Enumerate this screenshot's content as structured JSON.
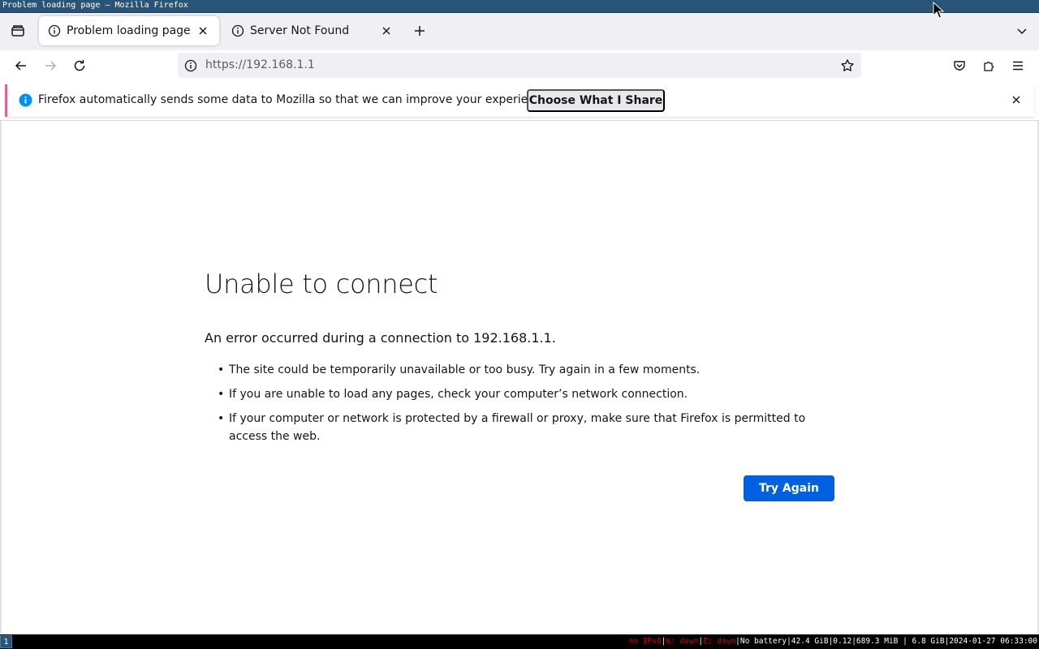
{
  "window": {
    "title": "Problem loading page — Mozilla Firefox"
  },
  "tabs": [
    {
      "label": "Problem loading page",
      "active": true,
      "icon": "info-icon"
    },
    {
      "label": "Server Not Found",
      "active": false,
      "icon": "info-icon"
    }
  ],
  "urlbar": {
    "url": "https://192.168.1.1"
  },
  "notification": {
    "text": "Firefox automatically sends some data to Mozilla so that we can improve your experience.",
    "button_label": "Choose What I Share",
    "accent_color": "#e3658e"
  },
  "error_page": {
    "title": "Unable to connect",
    "description": "An error occurred during a connection to 192.168.1.1.",
    "items": [
      "The site could be temporarily unavailable or too busy. Try again in a few moments.",
      "If you are unable to load any pages, check your computer’s network connection.",
      "If your computer or network is protected by a firewall or proxy, make sure that Firefox is permitted to access the web."
    ],
    "button_label": "Try Again",
    "button_color": "#0061e0"
  },
  "statusbar": {
    "workspace": "1",
    "ipv6": "no IPv6",
    "wireless": "W: down",
    "ethernet": "E: down",
    "battery": "No battery",
    "disk": "42.4 GiB",
    "load": "0.12",
    "memory": "689.3 MiB | 6.8 GiB",
    "datetime": "2024-01-27 06:33:00"
  }
}
